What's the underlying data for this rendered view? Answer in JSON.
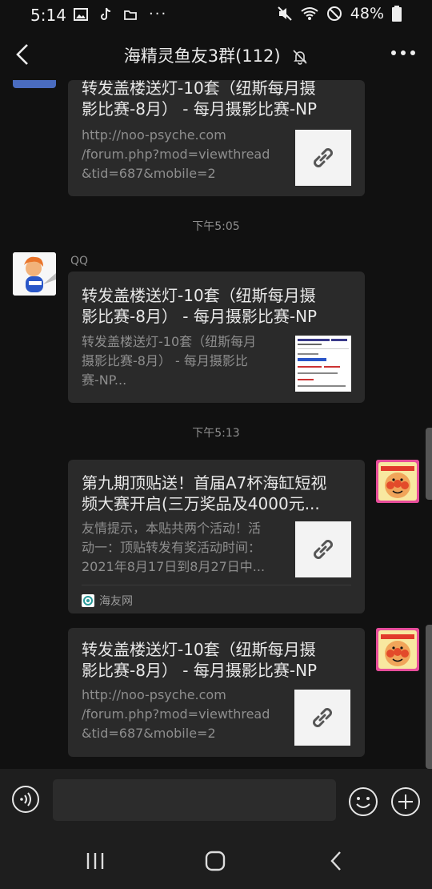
{
  "status_bar": {
    "time": "5:14",
    "battery": "48%"
  },
  "header": {
    "title": "海精灵鱼友3群(112)",
    "icons": [
      "back-icon",
      "mute-bell-icon",
      "more-icon"
    ]
  },
  "messages": [
    {
      "title_line1": "转发盖楼送灯-10套（纽斯每月摄",
      "title_line2": "影比赛-8月） - 每月摄影比赛-NP",
      "desc_line1": "http://noo-psyche.com",
      "desc_line2": "/forum.php?mod=viewthread",
      "desc_line3": "&tid=687&mobile=2",
      "thumb": "link-icon"
    },
    {
      "time": "下午5:05",
      "sender": "QQ",
      "title_line1": "转发盖楼送灯-10套（纽斯每月摄",
      "title_line2": "影比赛-8月） - 每月摄影比赛-NP",
      "desc_line1": "转发盖楼送灯-10套（纽斯每月",
      "desc_line2": "摄影比赛-8月） - 每月摄影比",
      "desc_line3": "赛-NP...",
      "thumb": "webpage-thumbnail"
    },
    {
      "time": "下午5:13",
      "title_line1": "第九期顶贴送！首届A7杯海缸短视",
      "title_line2": "频大赛开启(三万奖品及4000元...",
      "desc_line1": "友情提示，本贴共两个活动！活",
      "desc_line2": "动一：顶贴转发有奖活动时间：",
      "desc_line3": "2021年8月17日到8月27日中...",
      "source": "海友网",
      "thumb": "link-icon"
    },
    {
      "title_line1": "转发盖楼送灯-10套（纽斯每月摄",
      "title_line2": "影比赛-8月） - 每月摄影比赛-NP",
      "desc_line1": "http://noo-psyche.com",
      "desc_line2": "/forum.php?mod=viewthread",
      "desc_line3": "&tid=687&mobile=2",
      "thumb": "link-icon"
    }
  ],
  "input_bar": {
    "placeholder": "",
    "icons": [
      "voice-icon",
      "emoji-icon",
      "plus-icon"
    ]
  },
  "nav_bar": {
    "icons": [
      "recent-apps-icon",
      "home-icon",
      "back-nav-icon"
    ]
  },
  "colors": {
    "background": "#111111",
    "bubble": "#2a2a2a",
    "text": "#e8e8e8",
    "muted": "#8e8e8e"
  }
}
